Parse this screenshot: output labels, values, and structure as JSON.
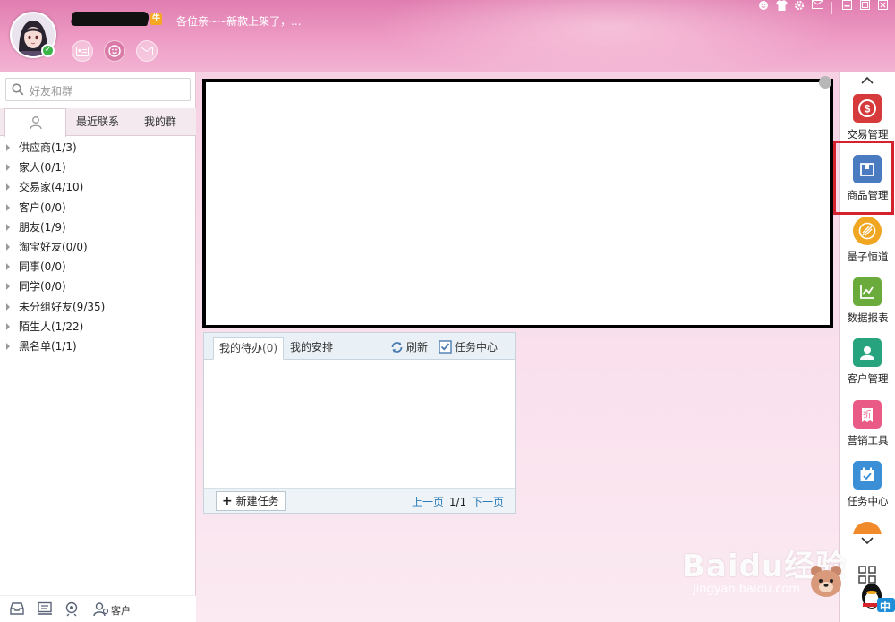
{
  "header": {
    "signature": "各位亲~~新款上架了，...",
    "vip_badge": "牛",
    "window_controls": [
      "face-icon",
      "skin-icon",
      "settings-icon",
      "mail-icon",
      "minimize-icon",
      "maximize-icon",
      "close-icon"
    ]
  },
  "left": {
    "search_placeholder": "好友和群",
    "tabs": [
      {
        "label": ""
      },
      {
        "label": "最近联系"
      },
      {
        "label": "我的群"
      }
    ],
    "groups": [
      {
        "label": "供应商(1/3)"
      },
      {
        "label": "家人(0/1)"
      },
      {
        "label": "交易家(4/10)"
      },
      {
        "label": "客户(0/0)"
      },
      {
        "label": "朋友(1/9)"
      },
      {
        "label": "淘宝好友(0/0)"
      },
      {
        "label": "同事(0/0)"
      },
      {
        "label": "同学(0/0)"
      },
      {
        "label": "未分组好友(9/35)"
      },
      {
        "label": "陌生人(1/22)"
      },
      {
        "label": "黑名单(1/1)"
      }
    ],
    "footer_label": "客户"
  },
  "tasks": {
    "tab_todo": "我的待办",
    "tab_todo_count": "(0)",
    "tab_arrange": "我的安排",
    "refresh": "刷新",
    "task_center": "任务中心",
    "new_task": "新建任务",
    "prev": "上一页",
    "page": "1/1",
    "next": "下一页"
  },
  "right_toolbar": {
    "items": [
      {
        "label": "交易管理",
        "icon": "dollar-icon",
        "color": "#d63a3a"
      },
      {
        "label": "商品管理",
        "icon": "package-icon",
        "color": "#4a7ac0"
      },
      {
        "label": "量子恒道",
        "icon": "quantum-icon",
        "color": "#f0a620"
      },
      {
        "label": "数据报表",
        "icon": "chart-icon",
        "color": "#6aab3c"
      },
      {
        "label": "客户管理",
        "icon": "customer-icon",
        "color": "#27a37d"
      },
      {
        "label": "营销工具",
        "icon": "discount-icon",
        "color": "#ea5a86"
      },
      {
        "label": "任务中心",
        "icon": "calendar-check-icon",
        "color": "#3b8fd6"
      }
    ],
    "ime_badge": "中"
  },
  "watermark": {
    "brand": "Baidu经验",
    "url": "jingyan.baidu.com"
  }
}
